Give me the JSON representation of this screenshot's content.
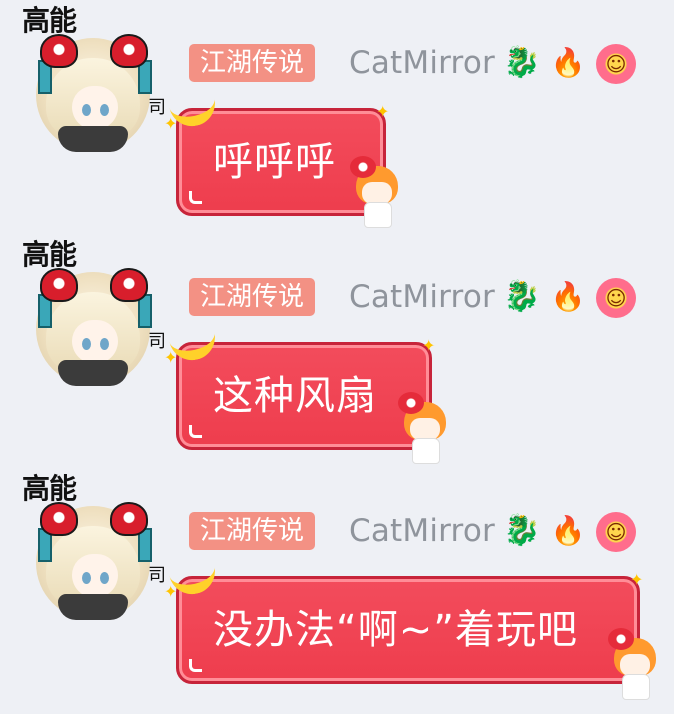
{
  "colors": {
    "background": "#eef0f5",
    "title_badge_bg": "#f39184",
    "bubble_red": "#ee3d4d",
    "nickname_gray": "#8f949c"
  },
  "messages": [
    {
      "side_label": "高能",
      "side_glyph": "司",
      "title_badge": "江湖传说",
      "nickname": "CatMirror",
      "badges": [
        "dragon-icon",
        "fire-icon",
        "grin-flower-icon"
      ],
      "text": "呼呼呼"
    },
    {
      "side_label": "高能",
      "side_glyph": "司",
      "title_badge": "江湖传说",
      "nickname": "CatMirror",
      "badges": [
        "dragon-icon",
        "fire-icon",
        "grin-flower-icon"
      ],
      "text": "这种风扇"
    },
    {
      "side_label": "高能",
      "side_glyph": "司",
      "title_badge": "江湖传说",
      "nickname": "CatMirror",
      "badges": [
        "dragon-icon",
        "fire-icon",
        "grin-flower-icon"
      ],
      "text": "没办法“啊~”着玩吧"
    }
  ]
}
